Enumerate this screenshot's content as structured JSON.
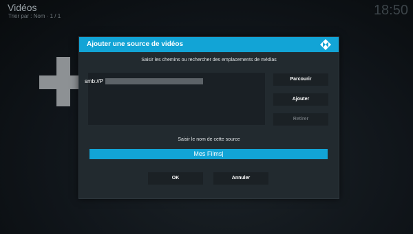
{
  "header": {
    "title": "Vidéos",
    "subtitle": "Trier par : Nom  ·  1 / 1",
    "clock": "18:50"
  },
  "dialog": {
    "title": "Ajouter une source de vidéos",
    "instruction": "Saisir les chemins ou rechercher des emplacements de médias",
    "paths": [
      "smb://P"
    ],
    "buttons": {
      "browse": "Parcourir",
      "add": "Ajouter",
      "remove": "Retirer"
    },
    "name_label": "Saisir le nom de cette source",
    "name_value": "Mes Films|",
    "ok": "OK",
    "cancel": "Annuler"
  },
  "icons": {
    "add": "plus-icon",
    "brand": "kodi-logo-icon"
  },
  "colors": {
    "accent": "#12a4d6",
    "dialog_bg": "#222a2f",
    "button_bg": "#1b2125",
    "disabled_text": "#6a7075"
  }
}
